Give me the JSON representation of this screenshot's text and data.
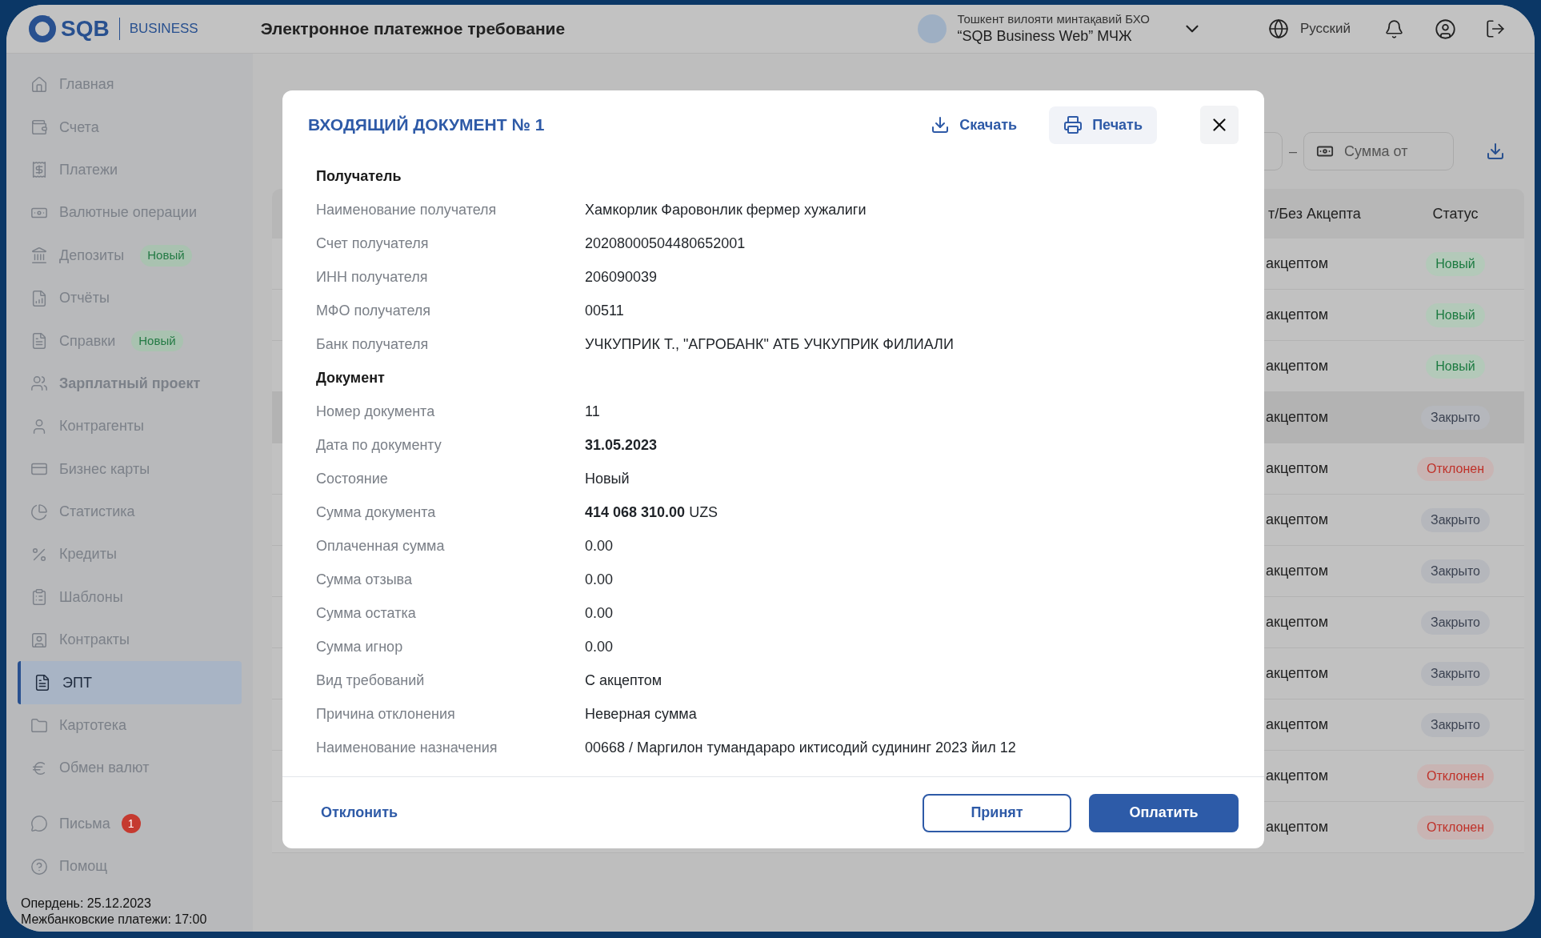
{
  "header": {
    "logo": {
      "brand": "SQB",
      "product": "BUSINESS"
    },
    "title": "Электронное платежное требование",
    "organization": {
      "line1": "Тошкент вилояти минтақавий БХО",
      "line2": "“SQB Business Web” МЧЖ"
    },
    "language": "Русский"
  },
  "sidebar": {
    "items": [
      {
        "label": "Главная",
        "selected": false
      },
      {
        "label": "Счета",
        "selected": false
      },
      {
        "label": "Платежи",
        "selected": false
      },
      {
        "label": "Валютные операции",
        "selected": false
      },
      {
        "label": "Депозиты",
        "selected": false,
        "badge": "Новый"
      },
      {
        "label": "Отчёты",
        "selected": false
      },
      {
        "label": "Справки",
        "selected": false,
        "badge": "Новый"
      },
      {
        "label": "Зарплатный проект",
        "selected": false,
        "emphasized": true
      },
      {
        "label": "Контрагенты",
        "selected": false
      },
      {
        "label": "Бизнес карты",
        "selected": false
      },
      {
        "label": "Статистика",
        "selected": false
      },
      {
        "label": "Кредиты",
        "selected": false
      },
      {
        "label": "Шаблоны",
        "selected": false
      },
      {
        "label": "Контракты",
        "selected": false
      },
      {
        "label": "ЭПТ",
        "selected": true
      },
      {
        "label": "Картотека",
        "selected": false
      },
      {
        "label": "Обмен валют",
        "selected": false
      }
    ],
    "bottom_items": [
      {
        "label": "Письма",
        "selected": false,
        "count": "1"
      },
      {
        "label": "Помощ",
        "selected": false
      }
    ],
    "footer": [
      "Опердень: 25.12.2023",
      "Межбанковские платежи: 17:00"
    ]
  },
  "filters": {
    "range_separator": "–",
    "amount_from": {
      "placeholder": "Сумма от"
    }
  },
  "table": {
    "columns": [
      "т/Без Акцепта",
      "Статус"
    ],
    "rows": [
      {
        "acceptance": "акцептом",
        "status": "Новый",
        "kind": "new",
        "selected": false
      },
      {
        "acceptance": "акцептом",
        "status": "Новый",
        "kind": "new",
        "selected": false
      },
      {
        "acceptance": "акцептом",
        "status": "Новый",
        "kind": "new",
        "selected": false
      },
      {
        "acceptance": "акцептом",
        "status": "Закрыто",
        "kind": "closed",
        "selected": true
      },
      {
        "acceptance": "акцептом",
        "status": "Отклонен",
        "kind": "rejected",
        "selected": false
      },
      {
        "acceptance": "акцептом",
        "status": "Закрыто",
        "kind": "closed",
        "selected": false
      },
      {
        "acceptance": "акцептом",
        "status": "Закрыто",
        "kind": "closed",
        "selected": false
      },
      {
        "acceptance": "акцептом",
        "status": "Закрыто",
        "kind": "closed",
        "selected": false
      },
      {
        "acceptance": "акцептом",
        "status": "Закрыто",
        "kind": "closed",
        "selected": false
      },
      {
        "acceptance": "акцептом",
        "status": "Закрыто",
        "kind": "closed",
        "selected": false
      },
      {
        "acceptance": "акцептом",
        "status": "Отклонен",
        "kind": "rejected",
        "selected": false
      },
      {
        "acceptance": "акцептом",
        "status": "Отклонен",
        "kind": "rejected",
        "selected": false
      }
    ]
  },
  "modal": {
    "title": "ВХОДЯЩИЙ ДОКУМЕНТ № 1",
    "download": "Скачать",
    "print": "Печать",
    "rows": [
      {
        "kind": "section",
        "label": "Получатель"
      },
      {
        "kind": "field",
        "label": "Наименование получателя",
        "value": "Хамкорлик Фаровонлик фермер хужалиги"
      },
      {
        "kind": "field",
        "label": "Счет получателя",
        "value": "20208000504480652001"
      },
      {
        "kind": "field",
        "label": "ИНН получателя",
        "value": "206090039"
      },
      {
        "kind": "field",
        "label": "МФО получателя",
        "value": "00511"
      },
      {
        "kind": "field",
        "label": "Банк получателя",
        "value": "УЧКУПРИК Т., \"АГРОБАНК\" АТБ УЧКУПРИК ФИЛИАЛИ"
      },
      {
        "kind": "section",
        "label": "Документ"
      },
      {
        "kind": "field",
        "label": "Номер документа",
        "value": "11"
      },
      {
        "kind": "field",
        "label": "Дата по документу",
        "value": "31.05.2023",
        "bold": true
      },
      {
        "kind": "field",
        "label": "Состояние",
        "value": "Новый"
      },
      {
        "kind": "field",
        "label": "Сумма документа",
        "value": "**414 068 310.00** UZS"
      },
      {
        "kind": "field",
        "label": "Оплаченная сумма",
        "value": "0.00"
      },
      {
        "kind": "field",
        "label": "Сумма отзыва",
        "value": "0.00"
      },
      {
        "kind": "field",
        "label": "Сумма остатка",
        "value": "0.00"
      },
      {
        "kind": "field",
        "label": "Сумма игнор",
        "value": "0.00"
      },
      {
        "kind": "field",
        "label": "Вид требований",
        "value": "С акцептом"
      },
      {
        "kind": "field",
        "label": "Причина отклонения",
        "value": "Неверная сумма"
      },
      {
        "kind": "field",
        "label": "Наименование назначения",
        "value": "00668 / Маргилон тумандараро иктисодий судининг 2023 йил 12"
      }
    ],
    "reject": "Отклонить",
    "accept": "Принят",
    "pay": "Оплатить"
  }
}
